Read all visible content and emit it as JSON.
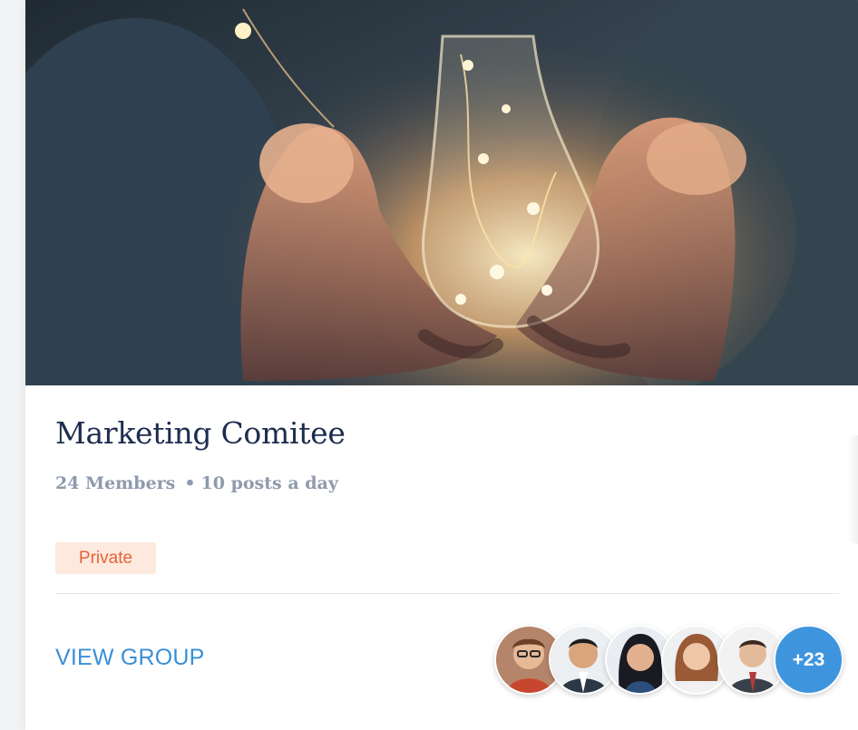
{
  "group": {
    "title": "Marketing Comitee",
    "members": "24 Members",
    "separator": "•",
    "activity": "10 posts a day",
    "badge": "Private",
    "action": "VIEW GROUP",
    "extra_members": "+23"
  },
  "hero_image": "glowing-lightbulb-in-hands",
  "avatars": [
    "member-avatar-1",
    "member-avatar-2",
    "member-avatar-3",
    "member-avatar-4",
    "member-avatar-5"
  ],
  "colors": {
    "title": "#1c2d4f",
    "meta": "#8e9aad",
    "badge_bg": "#fde9dd",
    "badge_text": "#e4643a",
    "link": "#3a8fd6",
    "more_bg": "#3e95dd"
  }
}
